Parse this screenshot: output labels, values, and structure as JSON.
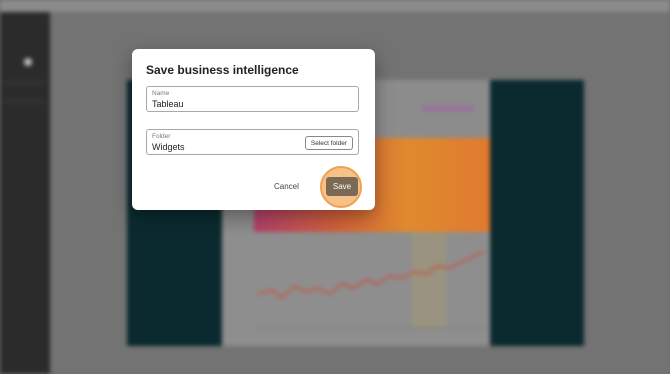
{
  "dialog": {
    "title": "Save business intelligence",
    "name_field": {
      "label": "Name",
      "value": "Tableau"
    },
    "folder_field": {
      "label": "Folder",
      "value": "Widgets",
      "button_label": "Select folder"
    },
    "cancel_label": "Cancel",
    "save_label": "Save"
  },
  "colors": {
    "overlay": "#6f6f6f",
    "dialog_bg": "#ffffff",
    "save_button": "#7a6a55",
    "highlight_fill": "#f6c28a",
    "highlight_ring": "#f0a04e",
    "dark_panel": "#0b2a2f"
  },
  "icons": [
    "dot-icon"
  ]
}
